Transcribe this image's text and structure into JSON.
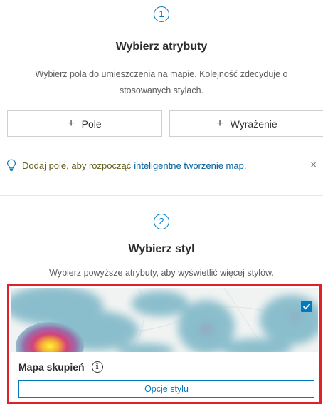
{
  "step1": {
    "number": "1",
    "title": "Wybierz atrybuty",
    "description_line1": "Wybierz pola do umieszczenia na mapie. Kolejność zdecyduje o",
    "description_line2": "stosowanych stylach.",
    "add_field_button": {
      "plus": "+",
      "label": "Pole"
    },
    "add_expression_button": {
      "plus": "+",
      "label": "Wyrażenie"
    }
  },
  "hint": {
    "icon": "lightbulb-icon",
    "text": "Dodaj pole, aby rozpocząć",
    "link": "inteligentne tworzenie map",
    "suffix": ".",
    "close": "×"
  },
  "step2": {
    "number": "2",
    "title": "Wybierz styl",
    "description": "Wybierz powyższe atrybuty, aby wyświetlić więcej stylów."
  },
  "style_card": {
    "title": "Mapa skupień",
    "info_icon": "i",
    "options_button": "Opcje stylu",
    "selected": true
  },
  "colors": {
    "accent": "#0079c1",
    "selection_border": "#e0202a"
  }
}
